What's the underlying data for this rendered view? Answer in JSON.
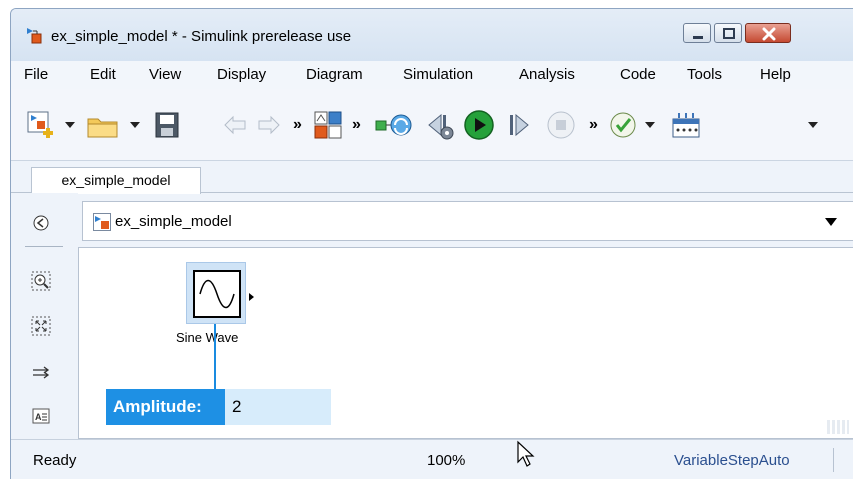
{
  "window": {
    "title": "ex_simple_model * - Simulink prerelease use"
  },
  "menu": {
    "items": [
      "File",
      "Edit",
      "View",
      "Display",
      "Diagram",
      "Simulation",
      "Analysis",
      "Code",
      "Tools",
      "Help"
    ]
  },
  "toolbar": {
    "icons": [
      "new-model-icon",
      "open-folder-icon",
      "save-icon",
      "back-arrow-icon",
      "forward-arrow-icon",
      "library-browser-icon",
      "model-explorer-icon",
      "update-diagram-icon",
      "step-back-icon",
      "run-icon",
      "step-forward-icon",
      "stop-icon",
      "model-advisor-icon",
      "simulation-data-icon"
    ]
  },
  "tabs": [
    {
      "label": "ex_simple_model"
    }
  ],
  "address": {
    "path": "ex_simple_model"
  },
  "canvas": {
    "block_label": "Sine Wave",
    "param_label": "Amplitude:",
    "param_value": "2"
  },
  "status": {
    "state": "Ready",
    "zoom": "100%",
    "solver": "VariableStepAuto"
  },
  "colors": {
    "accent": "#1e90e4",
    "selection": "#cfe3f6",
    "param_bg": "#d7ecfb",
    "run_green": "#25a13a",
    "close_red": "#c54a32"
  }
}
